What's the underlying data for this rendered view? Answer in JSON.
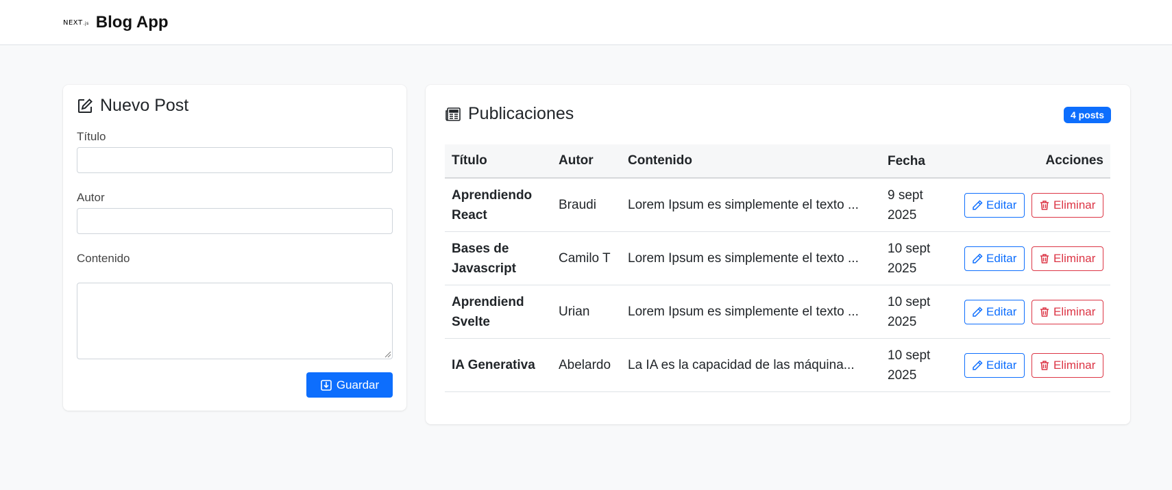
{
  "header": {
    "logo_text": "NEXT",
    "logo_suffix": ".js",
    "title": "Blog App"
  },
  "form": {
    "title": "Nuevo Post",
    "fields": {
      "titulo": {
        "label": "Título",
        "value": ""
      },
      "autor": {
        "label": "Autor",
        "value": ""
      },
      "contenido": {
        "label": "Contenido",
        "value": ""
      }
    },
    "save_label": "Guardar"
  },
  "posts": {
    "title": "Publicaciones",
    "badge": "4 posts",
    "columns": {
      "titulo": "Título",
      "autor": "Autor",
      "contenido": "Contenido",
      "fecha": "Fecha",
      "acciones": "Acciones"
    },
    "edit_label": "Editar",
    "delete_label": "Eliminar",
    "rows": [
      {
        "titulo_1": "Aprendiendo",
        "titulo_2": "React",
        "autor": "Braudi",
        "contenido": "Lorem Ipsum es simplemente el texto ...",
        "fecha_1": "9 sept",
        "fecha_2": "2025"
      },
      {
        "titulo_1": "Bases de",
        "titulo_2": "Javascript",
        "autor": "Camilo T",
        "contenido": "Lorem Ipsum es simplemente el texto ...",
        "fecha_1": "10 sept",
        "fecha_2": "2025"
      },
      {
        "titulo_1": "Aprendiend",
        "titulo_2": "Svelte",
        "autor": "Urian",
        "contenido": "Lorem Ipsum es simplemente el texto ...",
        "fecha_1": "10 sept",
        "fecha_2": "2025"
      },
      {
        "titulo_1": "IA Generativa",
        "titulo_2": "",
        "autor": "Abelardo",
        "contenido": "La IA es la capacidad de las máquina...",
        "fecha_1": "10 sept",
        "fecha_2": "2025"
      }
    ]
  },
  "colors": {
    "primary": "#0d6efd",
    "danger": "#dc3545",
    "background": "#f8f9fa"
  },
  "icons": {
    "edit_post": "pencil-square-icon",
    "publications": "newspaper-icon",
    "save": "download-box-icon",
    "edit": "pencil-icon",
    "delete": "trash-icon"
  }
}
